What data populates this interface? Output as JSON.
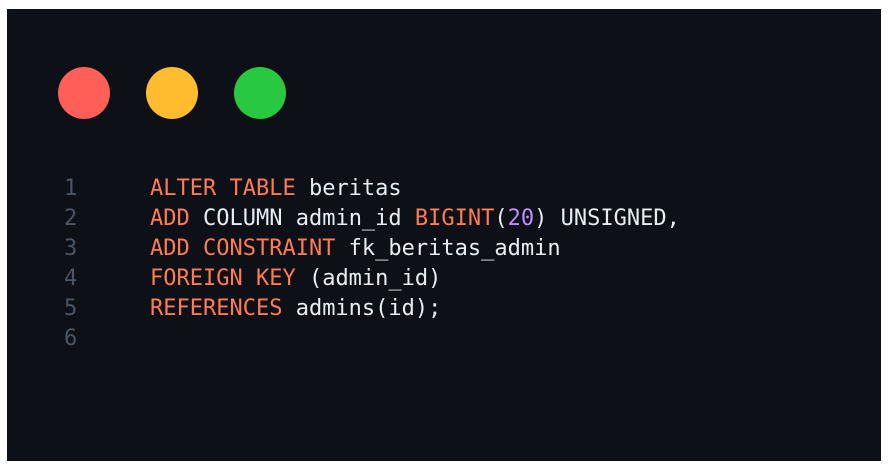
{
  "window": {
    "traffic_lights": [
      {
        "name": "close",
        "color": "#ff5f57"
      },
      {
        "name": "minimize",
        "color": "#febc2e"
      },
      {
        "name": "maximize",
        "color": "#28c840"
      }
    ]
  },
  "colors": {
    "keyword": "#ff7b54",
    "number": "#c08cff",
    "text": "#e6edf3",
    "line_number": "#4b5563",
    "background": "#0d1117"
  },
  "code": {
    "lines": [
      {
        "number": "1",
        "tokens": [
          {
            "t": "ALTER TABLE",
            "k": "keyword"
          },
          {
            "t": " beritas",
            "k": "text"
          }
        ]
      },
      {
        "number": "2",
        "tokens": [
          {
            "t": "ADD",
            "k": "keyword"
          },
          {
            "t": " COLUMN admin_id ",
            "k": "text"
          },
          {
            "t": "BIGINT",
            "k": "keyword"
          },
          {
            "t": "(",
            "k": "text"
          },
          {
            "t": "20",
            "k": "number"
          },
          {
            "t": ") UNSIGNED,",
            "k": "text"
          }
        ]
      },
      {
        "number": "3",
        "tokens": [
          {
            "t": "ADD CONSTRAINT",
            "k": "keyword"
          },
          {
            "t": " fk_beritas_admin",
            "k": "text"
          }
        ]
      },
      {
        "number": "4",
        "tokens": [
          {
            "t": "FOREIGN KEY",
            "k": "keyword"
          },
          {
            "t": " (admin_id)",
            "k": "text"
          }
        ]
      },
      {
        "number": "5",
        "tokens": [
          {
            "t": "REFERENCES",
            "k": "keyword"
          },
          {
            "t": " admins(id);",
            "k": "text"
          }
        ]
      },
      {
        "number": "6",
        "tokens": []
      }
    ]
  }
}
